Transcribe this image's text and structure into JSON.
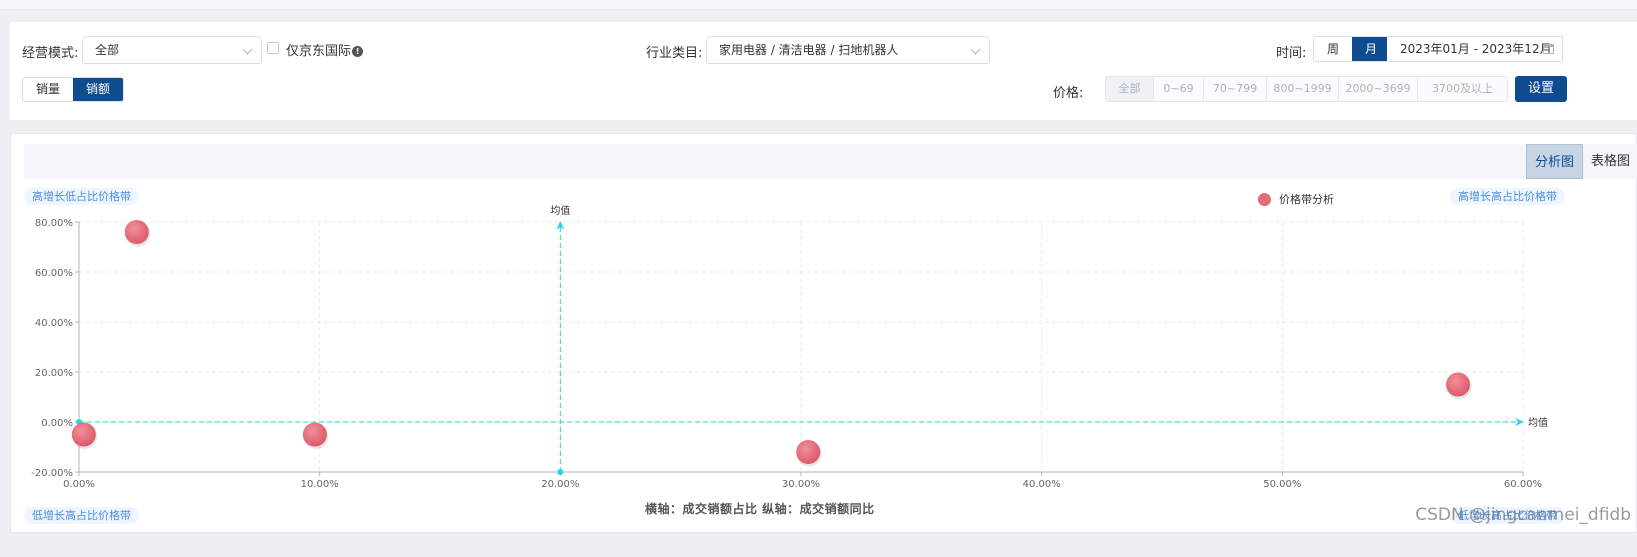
{
  "filters": {
    "business_mode_label": "经营模式:",
    "business_mode_value": "全部",
    "jd_intl_label": "仅京东国际",
    "industry_label": "行业类目:",
    "industry_value": "家用电器 / 清洁电器 / 扫地机器人",
    "time_label": "时间:",
    "time_tabs": [
      "周",
      "月"
    ],
    "date_range": "2023年01月 - 2023年12月",
    "metric_tabs": [
      "销量",
      "销额"
    ],
    "price_label": "价格:",
    "price_ranges": [
      "全部",
      "0~69",
      "70~799",
      "800~1999",
      "2000~3699",
      "3700及以上"
    ],
    "settings_button": "设置"
  },
  "view": {
    "tabs": [
      "分析图",
      "表格图"
    ],
    "active": "分析图"
  },
  "quadrants": {
    "top_left": "高增长低占比价格带",
    "top_right": "高增长高占比价格带",
    "bottom_left": "低增长高占比价格带",
    "bottom_right": "低增长高占比价格带"
  },
  "accent_color": "#0f4b8f",
  "bubble_color": "#e56b78",
  "mean_line_color": "#22d6e8",
  "watermark": "CSDN @jingcanmei_dfidb",
  "chart_data": {
    "type": "scatter",
    "legend": "价格带分析",
    "legend_position": "top-right",
    "xlabel": "横轴：成交销额占比  纵轴：成交销额同比",
    "xlim": [
      0,
      60
    ],
    "ylim": [
      -20,
      80
    ],
    "x_ticks": [
      "0.00%",
      "10.00%",
      "20.00%",
      "30.00%",
      "40.00%",
      "50.00%",
      "60.00%"
    ],
    "y_ticks": [
      "-20.00%",
      "0.00%",
      "20.00%",
      "40.00%",
      "60.00%",
      "80.00%"
    ],
    "mean_x": 20,
    "mean_y": 0,
    "mean_label": "均值",
    "grid": true,
    "points": [
      {
        "x": 2.4,
        "y": 76
      },
      {
        "x": 0.2,
        "y": -5
      },
      {
        "x": 9.8,
        "y": -5
      },
      {
        "x": 30.3,
        "y": -12
      },
      {
        "x": 57.3,
        "y": 15
      }
    ]
  }
}
